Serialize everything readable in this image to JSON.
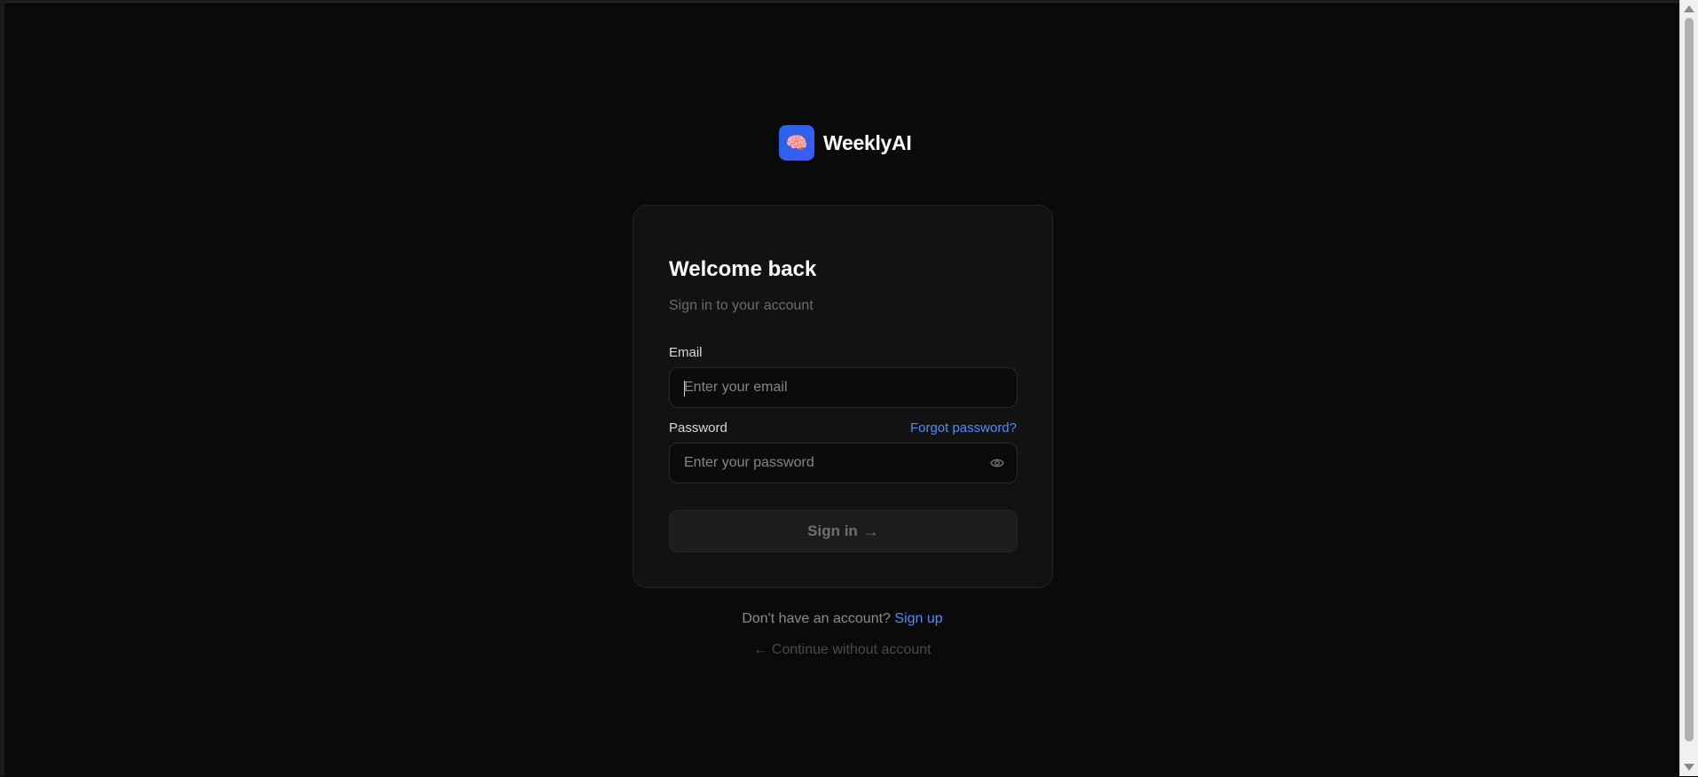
{
  "brand": {
    "name": "WeeklyAI",
    "logo_icon": "brain-icon",
    "logo_glyph": "🧠",
    "accent": "#2563eb"
  },
  "login": {
    "title": "Welcome back",
    "subtitle": "Sign in to your account",
    "email_label": "Email",
    "email_placeholder": "Enter your email",
    "email_value": "",
    "password_label": "Password",
    "password_placeholder": "Enter your password",
    "password_value": "",
    "forgot_label": "Forgot password?",
    "show_password_icon": "eye-icon",
    "submit_label": "Sign in",
    "submit_arrow": "→"
  },
  "footer": {
    "prompt": "Don't have an account?",
    "signup_label": "Sign up",
    "continue_label": "← Continue without account"
  },
  "colors": {
    "background": "#0a0a0a",
    "card": "#121212",
    "link": "#4d8cff"
  }
}
